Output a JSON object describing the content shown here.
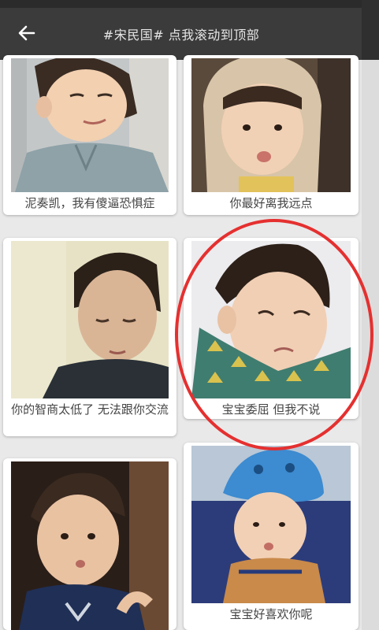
{
  "header": {
    "title": "#宋民国#  点我滚动到顶部",
    "back_icon": "arrow-left-icon"
  },
  "colors": {
    "header_bg": "#3b3b3b",
    "highlight": "#e53030",
    "card_bg": "#ffffff"
  },
  "grid": {
    "items": [
      {
        "caption": "泥奏凯，我有傻逼恐惧症"
      },
      {
        "caption": "你最好离我远点"
      },
      {
        "caption": "你的智商太低了    无法跟你交流"
      },
      {
        "caption": "宝宝委屈 但我不说"
      },
      {
        "caption": ""
      },
      {
        "caption": "宝宝好喜欢你呢"
      }
    ]
  }
}
